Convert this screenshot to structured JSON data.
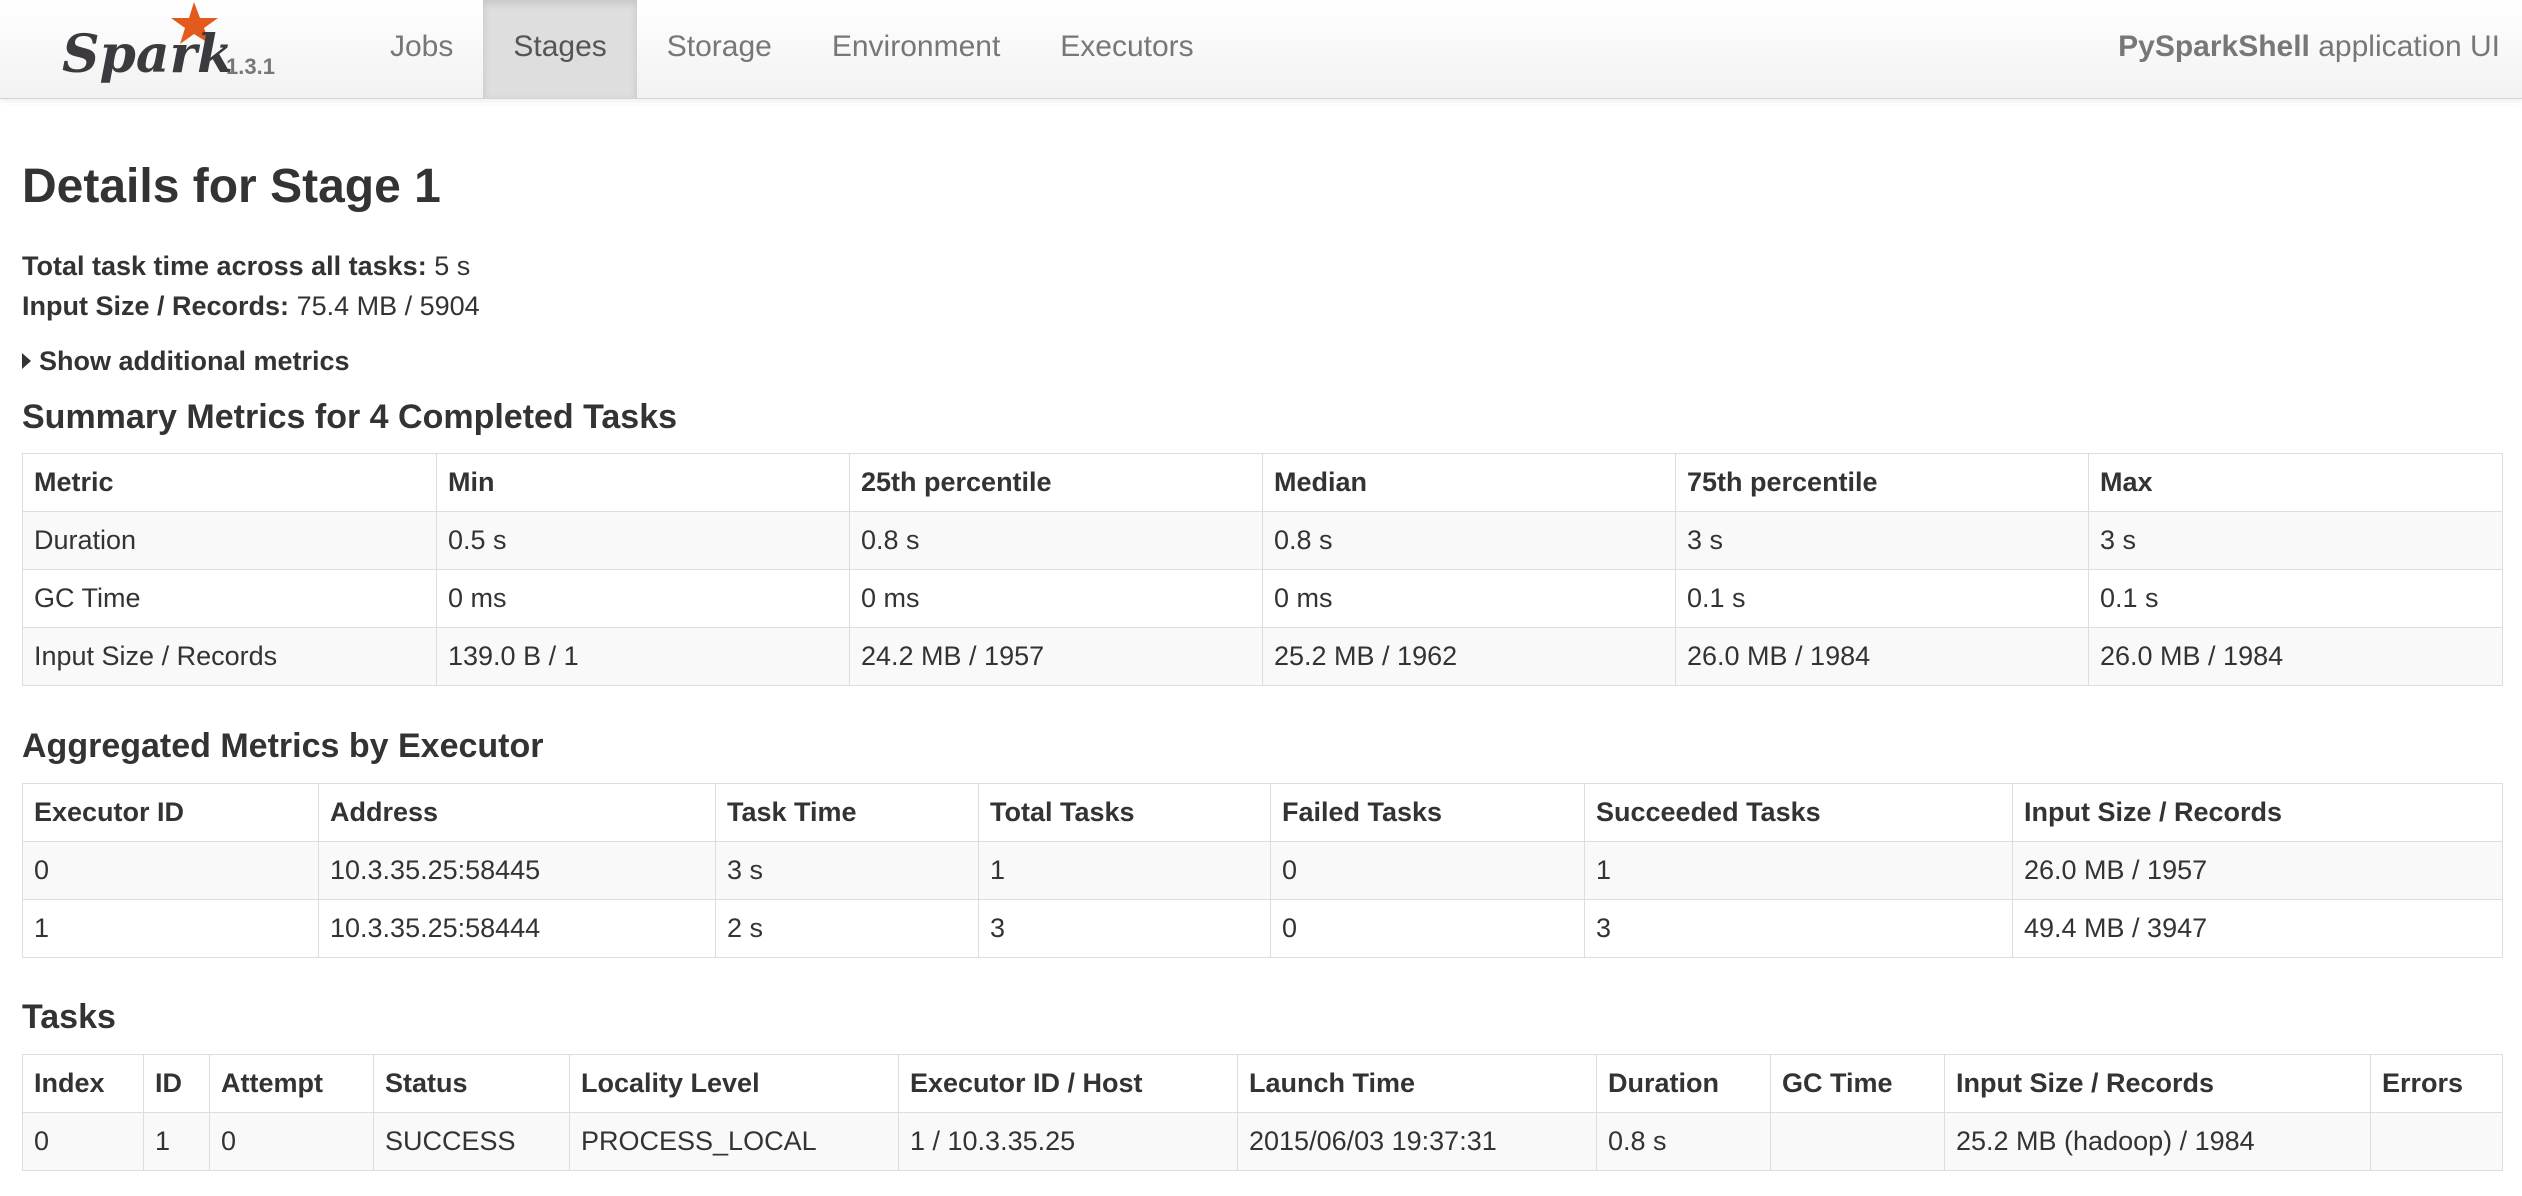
{
  "header": {
    "brand": "Spark",
    "version": "1.3.1",
    "nav": [
      {
        "label": "Jobs",
        "active": false
      },
      {
        "label": "Stages",
        "active": true
      },
      {
        "label": "Storage",
        "active": false
      },
      {
        "label": "Environment",
        "active": false
      },
      {
        "label": "Executors",
        "active": false
      }
    ],
    "app_name": "PySparkShell",
    "app_suffix": " application UI"
  },
  "page": {
    "title": "Details for Stage 1",
    "total_task_time_label": "Total task time across all tasks:",
    "total_task_time_value": "5 s",
    "input_size_label": "Input Size / Records:",
    "input_size_value": "75.4 MB / 5904",
    "show_additional_metrics": "Show additional metrics"
  },
  "summary_metrics": {
    "title": "Summary Metrics for 4 Completed Tasks",
    "columns": [
      "Metric",
      "Min",
      "25th percentile",
      "Median",
      "75th percentile",
      "Max"
    ],
    "rows": [
      [
        "Duration",
        "0.5 s",
        "0.8 s",
        "0.8 s",
        "3 s",
        "3 s"
      ],
      [
        "GC Time",
        "0 ms",
        "0 ms",
        "0 ms",
        "0.1 s",
        "0.1 s"
      ],
      [
        "Input Size / Records",
        "139.0 B / 1",
        "24.2 MB / 1957",
        "25.2 MB / 1962",
        "26.0 MB / 1984",
        "26.0 MB / 1984"
      ]
    ]
  },
  "executor_metrics": {
    "title": "Aggregated Metrics by Executor",
    "columns": [
      "Executor ID",
      "Address",
      "Task Time",
      "Total Tasks",
      "Failed Tasks",
      "Succeeded Tasks",
      "Input Size / Records"
    ],
    "rows": [
      [
        "0",
        "10.3.35.25:58445",
        "3 s",
        "1",
        "0",
        "1",
        "26.0 MB / 1957"
      ],
      [
        "1",
        "10.3.35.25:58444",
        "2 s",
        "3",
        "0",
        "3",
        "49.4 MB / 3947"
      ]
    ]
  },
  "tasks": {
    "title": "Tasks",
    "columns": [
      "Index",
      "ID",
      "Attempt",
      "Status",
      "Locality Level",
      "Executor ID / Host",
      "Launch Time",
      "Duration",
      "GC Time",
      "Input Size / Records",
      "Errors"
    ],
    "rows": [
      [
        "0",
        "1",
        "0",
        "SUCCESS",
        "PROCESS_LOCAL",
        "1 / 10.3.35.25",
        "2015/06/03 19:37:31",
        "0.8 s",
        "",
        "25.2 MB (hadoop) / 1984",
        ""
      ]
    ]
  },
  "colors": {
    "logo_orange": "#e25a1c",
    "logo_text": "#3c3a3e",
    "nav_text": "#777777",
    "active_tab_bg": "#dedede"
  }
}
